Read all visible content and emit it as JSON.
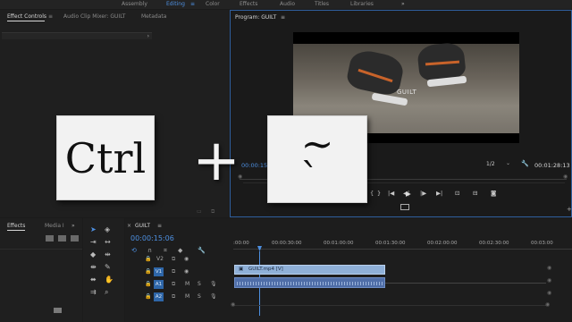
{
  "workspaces": {
    "items": [
      "Assembly",
      "Editing",
      "Color",
      "Effects",
      "Audio",
      "Titles",
      "Libraries"
    ],
    "active": "Editing",
    "menu_glyph": "≡",
    "more_glyph": "»"
  },
  "source_panel": {
    "tabs": [
      "Effect Controls",
      "Audio Clip Mixer: GUILT",
      "Metadata"
    ],
    "menu_glyph": "≡"
  },
  "program": {
    "title": "Program: GUILT",
    "menu_glyph": "≡",
    "video_caption": "GUILT",
    "timecode_left": "00:00:15",
    "fit_label": "1/2",
    "timecode_right": "00:01:28:13",
    "transport": [
      "◆",
      "{",
      "}",
      "|◀",
      "◀|",
      "▶",
      "|▶",
      "▶|",
      "⊡",
      "⊟",
      "◙"
    ]
  },
  "overlay": {
    "key_left": "Ctrl",
    "plus": "+",
    "key_right_top": "~",
    "key_right_bottom": "`"
  },
  "effects_panel": {
    "tabs": [
      "Effects",
      "Media I"
    ],
    "more_glyph": "»"
  },
  "timeline": {
    "tab": "GUILT",
    "close_glyph": "×",
    "menu_glyph": "≡",
    "timecode": "00:00:15:06",
    "ruler": [
      ":00:00",
      "00:00:30:00",
      "00:01:00:00",
      "00:01:30:00",
      "00:02:00:00",
      "00:02:30:00",
      "00:03:00"
    ],
    "tracks": [
      {
        "name": "V2",
        "target": "",
        "type": "video"
      },
      {
        "name": "V1",
        "target": "V1",
        "type": "video"
      },
      {
        "name": "A1",
        "target": "A1",
        "type": "audio",
        "m": "M",
        "s": "S"
      },
      {
        "name": "A2",
        "target": "A2",
        "type": "audio",
        "m": "M",
        "s": "S"
      }
    ],
    "video_clip": "GUILT.mp4 [V]",
    "accent": "#2e66a8",
    "video_clip_color": "#8fb0d8",
    "audio_clip_color": "#4f6ea8"
  }
}
